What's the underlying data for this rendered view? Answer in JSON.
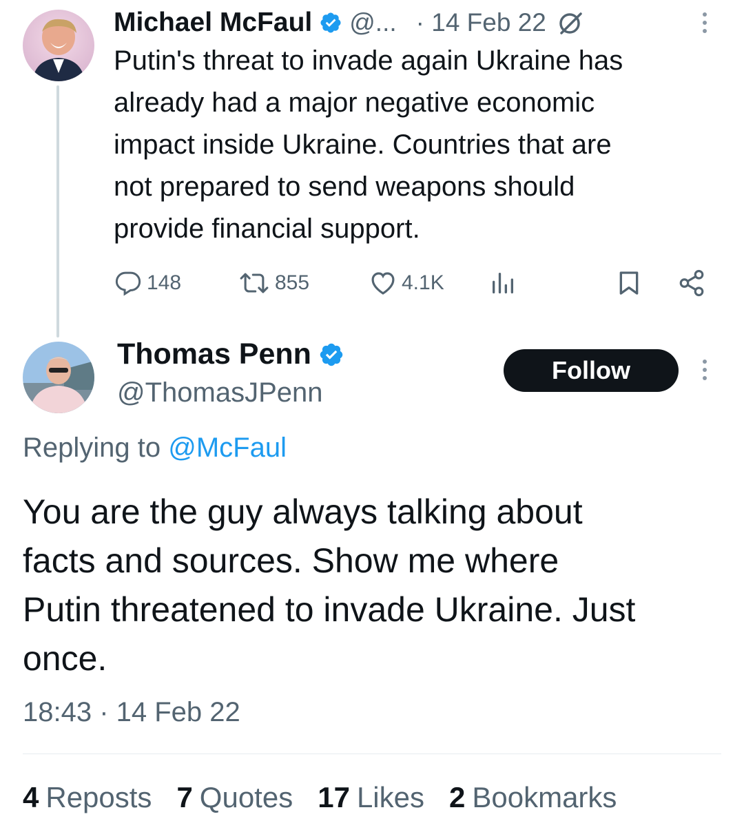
{
  "colors": {
    "accent": "#1d9bf0",
    "text": "#0f1419",
    "muted": "#536471",
    "verified": "#1d9bf0",
    "follow_bg": "#0f1419"
  },
  "parent": {
    "display_name": "Michael McFaul",
    "handle": "@...",
    "date": "· 14 Feb 22",
    "text": "Putin's threat to invade again Ukraine has\nalready had a major negative economic\nimpact inside Ukraine. Countries that are\nnot prepared to send weapons should\nprovide financial support.",
    "actions": {
      "replies": "148",
      "reposts": "855",
      "likes": "4.1K"
    }
  },
  "reply": {
    "display_name": "Thomas Penn",
    "handle": "@ThomasJPenn",
    "follow_label": "Follow",
    "replying_prefix": "Replying to ",
    "replying_to": "@McFaul",
    "text": "You are the guy always talking about\nfacts and sources. Show me where\nPutin threatened to invade Ukraine. Just\nonce.",
    "timestamp": "18:43 · 14 Feb 22",
    "stats": [
      {
        "count": "4",
        "label": "Reposts"
      },
      {
        "count": "7",
        "label": "Quotes"
      },
      {
        "count": "17",
        "label": "Likes"
      },
      {
        "count": "2",
        "label": "Bookmarks"
      }
    ]
  }
}
